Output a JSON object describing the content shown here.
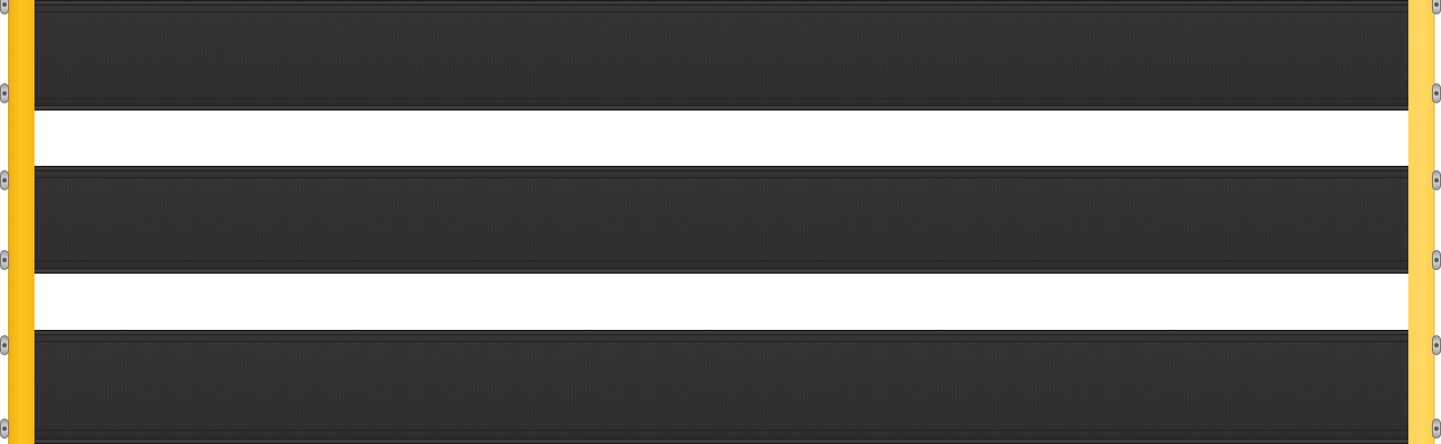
{
  "image_description": {
    "subject": "pedalboard",
    "rail_count": 3,
    "gap_count": 2,
    "side_bracket_count": 2,
    "bolt_count_per_side": 6
  },
  "colors": {
    "rail_body": "#303030",
    "rail_edge": "#1c1c1c",
    "left_bracket": "#ffc41f",
    "right_bracket": "#ffd964",
    "gap": "#ffffff",
    "bolt": "#b0b0b0"
  }
}
